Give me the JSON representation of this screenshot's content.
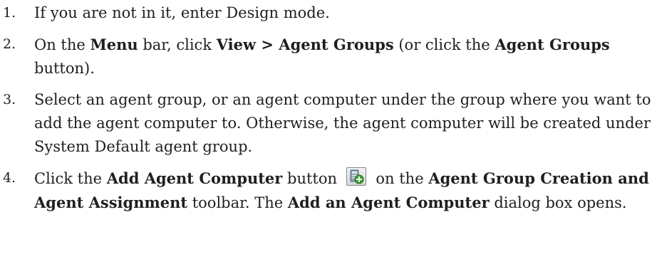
{
  "steps": [
    {
      "number": "1.",
      "segments": [
        {
          "text": "If you are not in it, enter Design mode.",
          "bold": false
        }
      ]
    },
    {
      "number": "2.",
      "segments": [
        {
          "text": "On the ",
          "bold": false
        },
        {
          "text": "Menu",
          "bold": true
        },
        {
          "text": " bar, click ",
          "bold": false
        },
        {
          "text": "View > Agent Groups",
          "bold": true
        },
        {
          "text": " (or click the ",
          "bold": false
        },
        {
          "text": "Agent Groups",
          "bold": true
        },
        {
          "text": " button).",
          "bold": false
        }
      ]
    },
    {
      "number": "3.",
      "segments": [
        {
          "text": "Select an agent group, or an agent computer under the group where you want to add the agent computer to. Otherwise, the agent computer will be created under System Default agent group.",
          "bold": false
        }
      ]
    },
    {
      "number": "4.",
      "segments": [
        {
          "text": "Click the ",
          "bold": false
        },
        {
          "text": "Add Agent Computer",
          "bold": true
        },
        {
          "text": " button ",
          "bold": false
        },
        {
          "icon": "add-agent-computer-icon"
        },
        {
          "text": " on the ",
          "bold": false
        },
        {
          "text": "Agent Group Creation and Agent Assignment",
          "bold": true
        },
        {
          "text": " toolbar. The ",
          "bold": false
        },
        {
          "text": "Add an Agent Computer",
          "bold": true
        },
        {
          "text": " dialog box opens.",
          "bold": false
        }
      ]
    }
  ],
  "colors": {
    "text": "#1f1f1f",
    "icon_plus": "#3aa532",
    "icon_computer": "#8fa3b8"
  }
}
